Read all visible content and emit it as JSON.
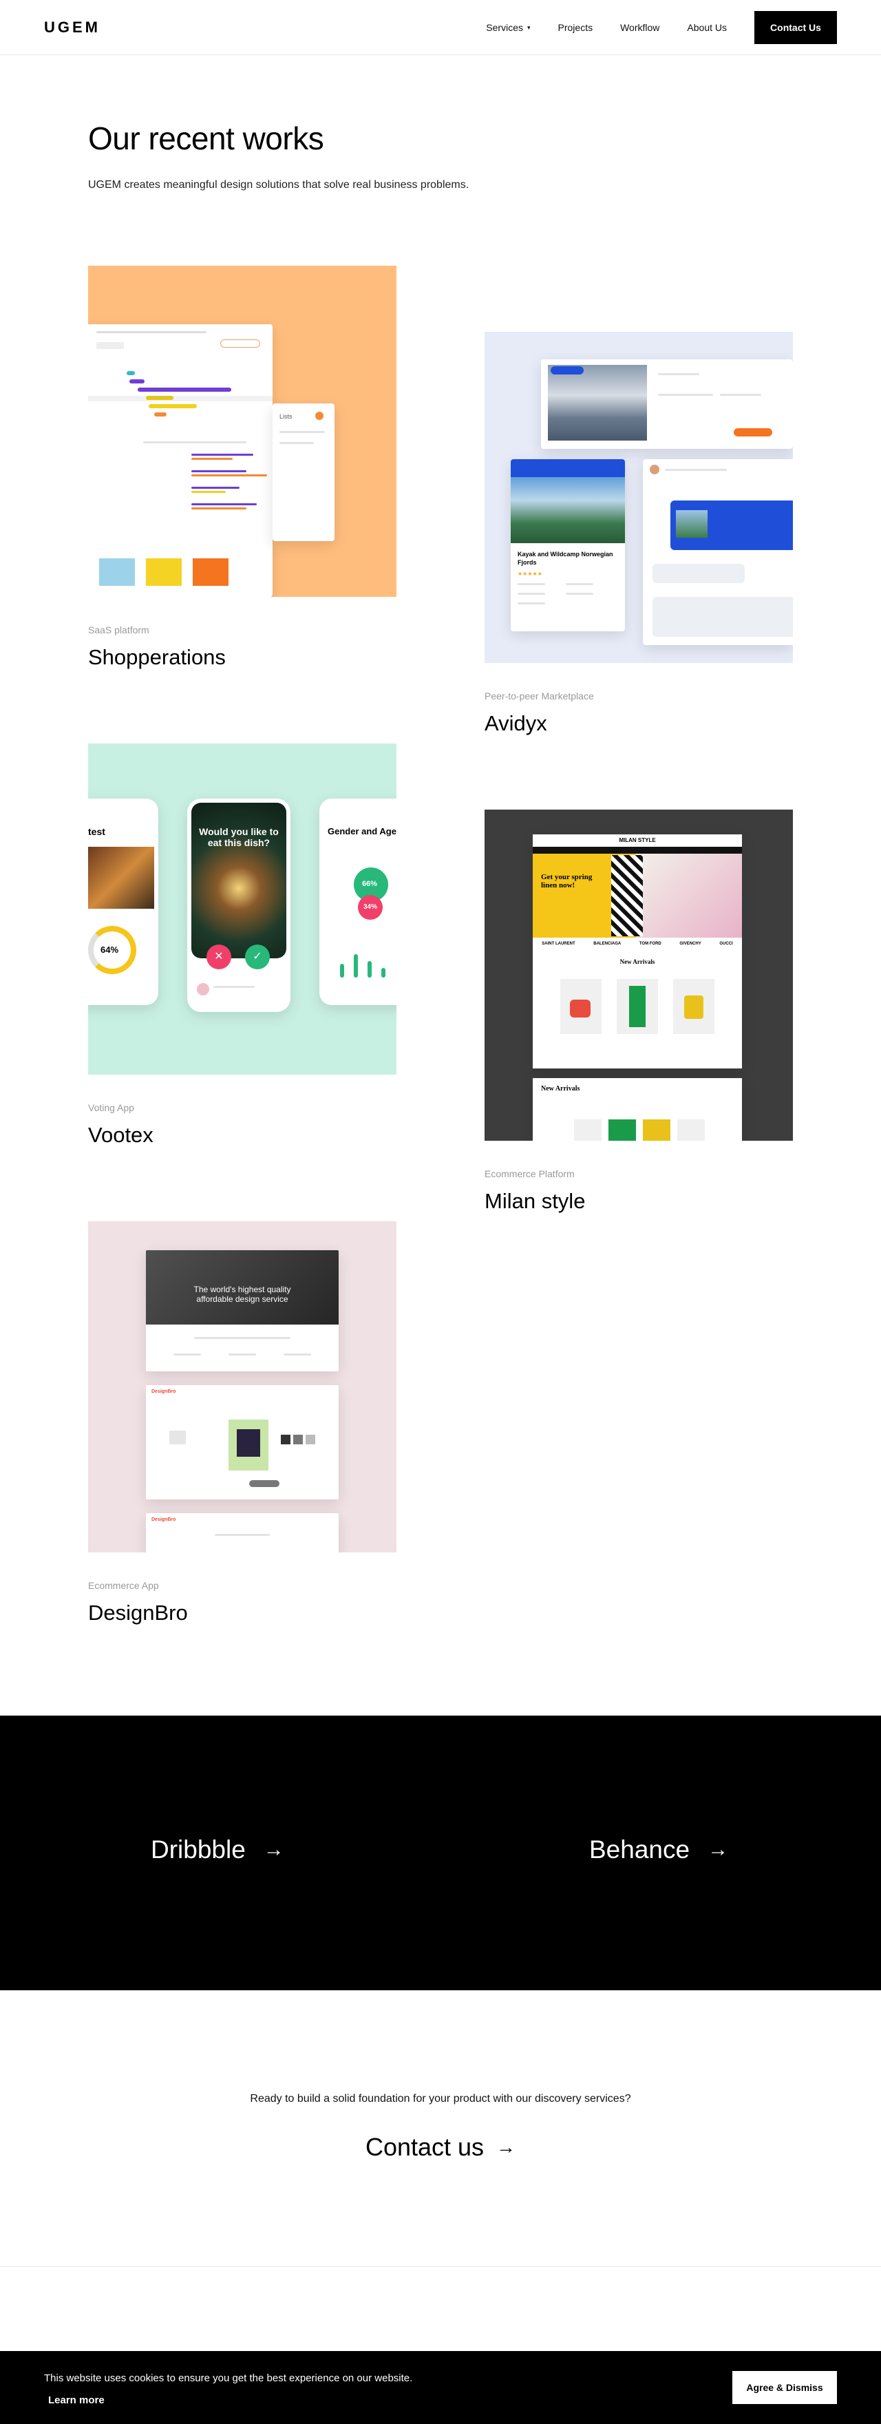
{
  "header": {
    "logo": "UGEM",
    "nav": [
      {
        "label": "Services",
        "has_dropdown": true
      },
      {
        "label": "Projects"
      },
      {
        "label": "Workflow"
      },
      {
        "label": "About Us"
      }
    ],
    "contact_button": "Contact Us"
  },
  "hero": {
    "title": "Our recent works",
    "subtitle": "UGEM creates meaningful design solutions that solve real business problems."
  },
  "projects": [
    {
      "category": "SaaS platform",
      "name": "Shopperations",
      "bg": "#ffbd7d"
    },
    {
      "category": "Peer-to-peer Marketplace",
      "name": "Avidyx",
      "bg": "#e6ebf7"
    },
    {
      "category": "Voting App",
      "name": "Vootex",
      "bg": "#c8f0e2"
    },
    {
      "category": "Ecommerce Platform",
      "name": "Milan style",
      "bg": "#3d3d3d"
    },
    {
      "category": "Ecommerce App",
      "name": "DesignBro",
      "bg": "#f0e1e4"
    }
  ],
  "mock_text": {
    "vootex_question": "Would you like to eat this dish?",
    "vootex_gender": "Gender and Age",
    "vootex_pct1": "64%",
    "vootex_pct2": "66%",
    "vootex_pct3": "34%",
    "vootex_test": "test",
    "milan_logo": "MILAN STYLE",
    "milan_hero": "Get your spring linen now!",
    "milan_arrivals": "New Arrivals",
    "milan_brands": [
      "SAINT LAURENT",
      "BALENCIAGA",
      "TOM FORD",
      "GIVENCHY",
      "GUCCI"
    ],
    "designbro_hero": "The world's highest quality affordable design service",
    "designbro_brand": "DesignBro",
    "avidyx_title": "Kayak and Wildcamp Norwegian Fjords",
    "shopperations_tab": "Lists"
  },
  "social": [
    {
      "label": "Dribbble",
      "arrow": "→"
    },
    {
      "label": "Behance",
      "arrow": "→"
    }
  ],
  "cta": {
    "question": "Ready to build a solid foundation for your product with our discovery services?",
    "link": "Contact us",
    "arrow": "→"
  },
  "cookie": {
    "text": "This website uses cookies to ensure you get the best experience on our website.",
    "learn_more": "Learn more",
    "button": "Agree & Dismiss"
  },
  "colors": {
    "black": "#000000",
    "orange": "#ffbd7d",
    "purple": "#6e3ed6",
    "blue": "#1f4fd9",
    "green": "#27b87a",
    "pink": "#f0406a"
  }
}
